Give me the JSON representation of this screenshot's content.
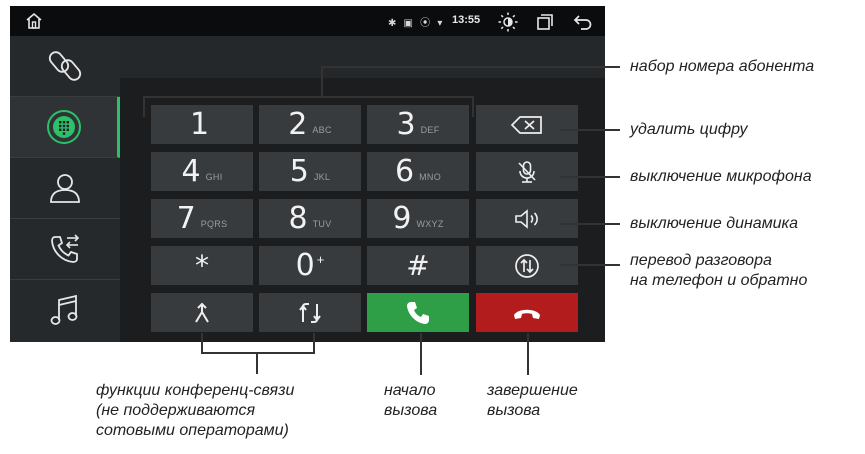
{
  "status_bar": {
    "icons_text": "✱ ▣ ⦿ ▾",
    "time": "13:55"
  },
  "keypad": [
    {
      "digit": "1",
      "letters": ""
    },
    {
      "digit": "2",
      "letters": "ABC"
    },
    {
      "digit": "3",
      "letters": "DEF"
    },
    {
      "digit": "4",
      "letters": "GHI"
    },
    {
      "digit": "5",
      "letters": "JKL"
    },
    {
      "digit": "6",
      "letters": "MNO"
    },
    {
      "digit": "7",
      "letters": "PQRS"
    },
    {
      "digit": "8",
      "letters": "TUV"
    },
    {
      "digit": "9",
      "letters": "WXYZ"
    },
    {
      "digit": "*",
      "letters": ""
    },
    {
      "digit": "0",
      "letters": "+"
    },
    {
      "digit": "#",
      "letters": ""
    }
  ],
  "annotations": {
    "number_entry": "набор номера абонента",
    "delete_digit": "удалить цифру",
    "mic_off": "выключение микрофона",
    "speaker_off": "выключение динамика",
    "transfer_line1": "перевод разговора",
    "transfer_line2": "на телефон и обратно",
    "conference_line1": "функции конференц-связи",
    "conference_line2": "(не поддерживаются",
    "conference_line3": "сотовыми операторами)",
    "call_start_line1": "начало",
    "call_start_line2": "вызова",
    "call_end_line1": "завершение",
    "call_end_line2": "вызова"
  },
  "icons": {
    "sidebar": [
      "bluetooth-link-icon",
      "dialpad-icon",
      "contacts-icon",
      "call-log-icon",
      "music-icon"
    ],
    "functions": [
      "backspace-icon",
      "mic-mute-icon",
      "speaker-icon",
      "transfer-icon"
    ],
    "bottom": [
      "merge-call-icon",
      "swap-call-icon",
      "call-icon",
      "end-call-icon"
    ]
  },
  "colors": {
    "accent_green": "#2cc06a",
    "call_green": "#2e9e47",
    "end_red": "#b31c1c"
  }
}
